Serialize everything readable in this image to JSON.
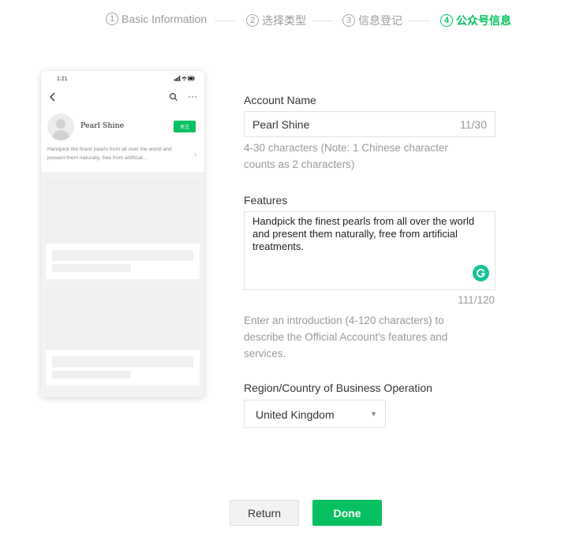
{
  "stepper": {
    "steps": [
      {
        "num": "1",
        "label": "Basic Information"
      },
      {
        "num": "2",
        "label": "选择类型"
      },
      {
        "num": "3",
        "label": "信息登记"
      },
      {
        "num": "4",
        "label": "公众号信息"
      }
    ],
    "active_step": 4
  },
  "preview": {
    "time": "1:21",
    "status_icons": "▮▮ ◉ ▭",
    "name": "Pearl Shine",
    "follow_label": "关注",
    "description": "Handpick the finest pearls from all over the world and present them naturally, free from artificial..."
  },
  "form": {
    "account_name": {
      "label": "Account Name",
      "value": "Pearl Shine",
      "counter": "11/30",
      "hint": "4-30 characters (Note: 1 Chinese character counts as 2 characters)"
    },
    "features": {
      "label": "Features",
      "value": "Handpick the finest pearls from all over the world and present them naturally, free from artificial treatments.",
      "counter": "111/120",
      "hint": "Enter an introduction (4-120 characters) to describe the Official Account's features and services."
    },
    "region": {
      "label": "Region/Country of Business Operation",
      "value": "United Kingdom"
    }
  },
  "buttons": {
    "return_label": "Return",
    "done_label": "Done"
  },
  "colors": {
    "accent": "#07c160",
    "grammarly": "#15c39a"
  }
}
